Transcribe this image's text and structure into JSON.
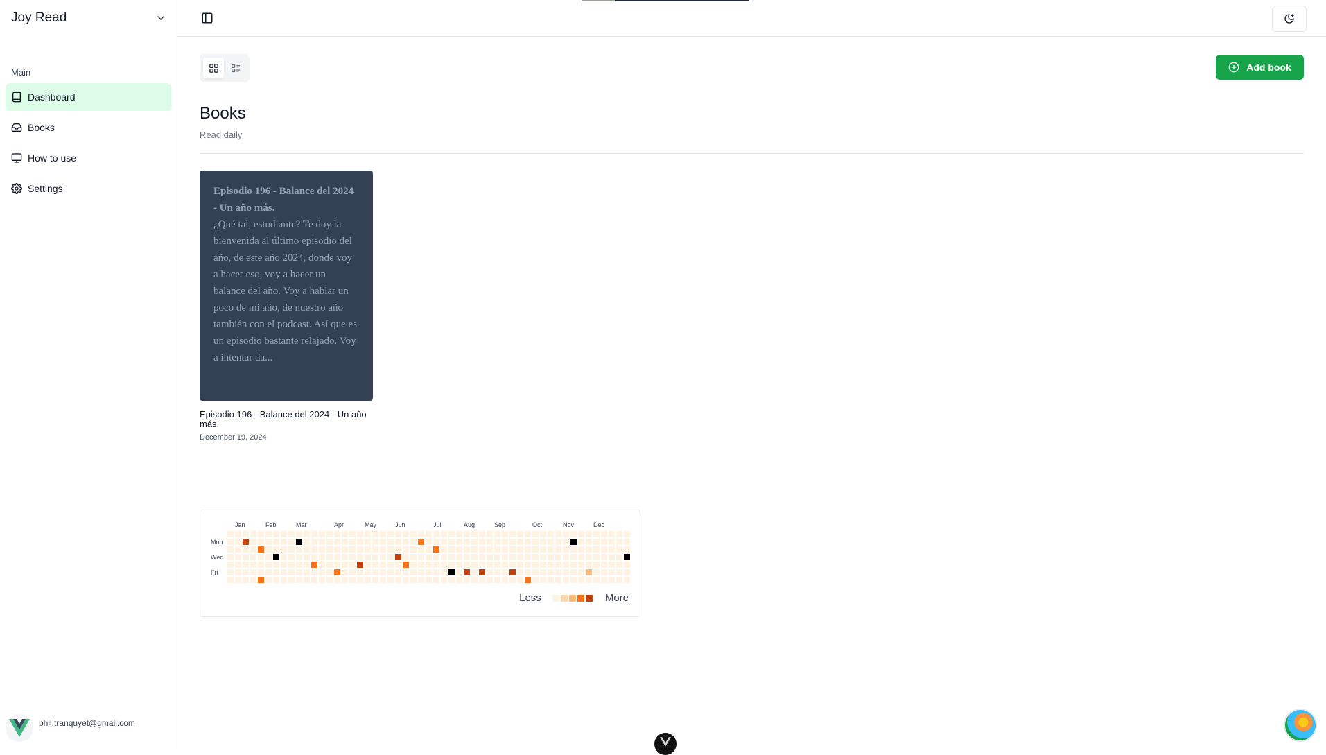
{
  "app": {
    "title": "Joy Read"
  },
  "sidebar": {
    "section_label": "Main",
    "items": [
      {
        "label": "Dashboard",
        "icon": "book-icon",
        "active": true
      },
      {
        "label": "Books",
        "icon": "inbox-icon",
        "active": false
      },
      {
        "label": "How to use",
        "icon": "monitor-icon",
        "active": false
      },
      {
        "label": "Settings",
        "icon": "gear-icon",
        "active": false
      }
    ],
    "user": {
      "email": "phil.tranquyet@gmail.com",
      "logo": "vue-logo"
    }
  },
  "header": {
    "add_button_label": "Add book"
  },
  "page": {
    "title": "Books",
    "subtitle": "Read daily"
  },
  "books": [
    {
      "cover_title": "Episodio 196 - Balance del 2024 - Un año más.",
      "cover_excerpt": "¿Qué tal, estudiante? Te doy la bienvenida al último episodio del año, de este año 2024, donde voy a hacer eso, voy a hacer un balance del año. Voy a hablar un poco de mi año, de nuestro año también con el podcast. Así que es un episodio bastante relajado. Voy a intentar da...",
      "title": "Episodio 196 - Balance del 2024 - Un año más.",
      "date": "December 19, 2024"
    }
  ],
  "heatmap": {
    "months": [
      "Jan",
      "Feb",
      "Mar",
      "Apr",
      "May",
      "Jun",
      "Jul",
      "Aug",
      "Sep",
      "Oct",
      "Nov",
      "Dec"
    ],
    "weekday_labels": {
      "mon": "Mon",
      "wed": "Wed",
      "fri": "Fri"
    },
    "legend_less": "Less",
    "legend_more": "More",
    "colors": {
      "empty": "#fef3e2",
      "l1": "#fed7aa",
      "l2": "#fdba74",
      "l3": "#fb923c",
      "l4": "#f97316",
      "l5": "#c2410c",
      "max": "#000000"
    },
    "legend_colors": [
      "#fef3e2",
      "#fed7aa",
      "#fdba74",
      "#f97316",
      "#c2410c"
    ],
    "activity": [
      {
        "week": 2,
        "day": 1,
        "level": "l5"
      },
      {
        "week": 4,
        "day": 2,
        "level": "l4"
      },
      {
        "week": 4,
        "day": 6,
        "level": "l4"
      },
      {
        "week": 6,
        "day": 3,
        "level": "max"
      },
      {
        "week": 9,
        "day": 1,
        "level": "max"
      },
      {
        "week": 11,
        "day": 4,
        "level": "l4"
      },
      {
        "week": 14,
        "day": 5,
        "level": "l4"
      },
      {
        "week": 17,
        "day": 4,
        "level": "l5"
      },
      {
        "week": 22,
        "day": 3,
        "level": "l5"
      },
      {
        "week": 23,
        "day": 4,
        "level": "l4"
      },
      {
        "week": 25,
        "day": 1,
        "level": "l4"
      },
      {
        "week": 27,
        "day": 2,
        "level": "l4"
      },
      {
        "week": 29,
        "day": 5,
        "level": "max"
      },
      {
        "week": 31,
        "day": 5,
        "level": "l5"
      },
      {
        "week": 33,
        "day": 5,
        "level": "l5"
      },
      {
        "week": 37,
        "day": 5,
        "level": "l5"
      },
      {
        "week": 39,
        "day": 6,
        "level": "l4"
      },
      {
        "week": 45,
        "day": 1,
        "level": "max"
      },
      {
        "week": 47,
        "day": 5,
        "level": "l2"
      },
      {
        "week": 52,
        "day": 3,
        "level": "max"
      }
    ]
  }
}
